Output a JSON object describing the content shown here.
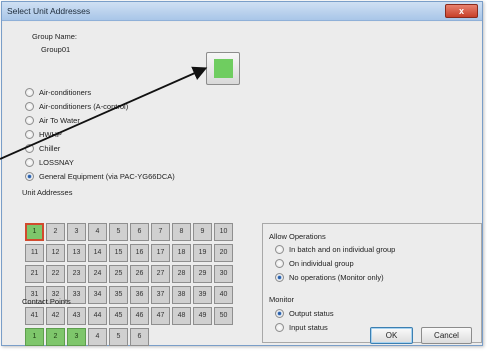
{
  "window": {
    "title": "Select Unit Addresses",
    "close_label": "x"
  },
  "group": {
    "label": "Group Name:",
    "value": "Group01"
  },
  "preview": {
    "color": "#6fcd60"
  },
  "unit_types": [
    {
      "label": "Air-conditioners",
      "checked": false
    },
    {
      "label": "Air-conditioners (A-control)",
      "checked": false
    },
    {
      "label": "Air To Water",
      "checked": false
    },
    {
      "label": "HWHP",
      "checked": false
    },
    {
      "label": "Chiller",
      "checked": false
    },
    {
      "label": "LOSSNAY",
      "checked": false
    },
    {
      "label": "General Equipment (via PAC-YG66DCA)",
      "checked": true
    }
  ],
  "unit_addresses": {
    "label": "Unit Addresses",
    "cells": [
      "1",
      "2",
      "3",
      "4",
      "5",
      "6",
      "7",
      "8",
      "9",
      "10",
      "11",
      "12",
      "13",
      "14",
      "15",
      "16",
      "17",
      "18",
      "19",
      "20",
      "21",
      "22",
      "23",
      "24",
      "25",
      "26",
      "27",
      "28",
      "29",
      "30",
      "31",
      "32",
      "33",
      "34",
      "35",
      "36",
      "37",
      "38",
      "39",
      "40",
      "41",
      "42",
      "43",
      "44",
      "45",
      "46",
      "47",
      "48",
      "49",
      "50"
    ],
    "selected": [
      "1"
    ]
  },
  "contact_points": {
    "label": "Contact Points",
    "cells": [
      "1",
      "2",
      "3",
      "4",
      "5",
      "6"
    ],
    "active": [
      "1",
      "2",
      "3"
    ]
  },
  "allow_operations": {
    "label": "Allow Operations",
    "options": [
      {
        "label": "In batch and on individual group",
        "checked": false
      },
      {
        "label": "On individual group",
        "checked": false
      },
      {
        "label": "No operations (Monitor only)",
        "checked": true
      }
    ]
  },
  "monitor": {
    "label": "Monitor",
    "options": [
      {
        "label": "Output status",
        "checked": true
      },
      {
        "label": "Input status",
        "checked": false
      }
    ]
  },
  "buttons": {
    "ok": "OK",
    "cancel": "Cancel"
  }
}
